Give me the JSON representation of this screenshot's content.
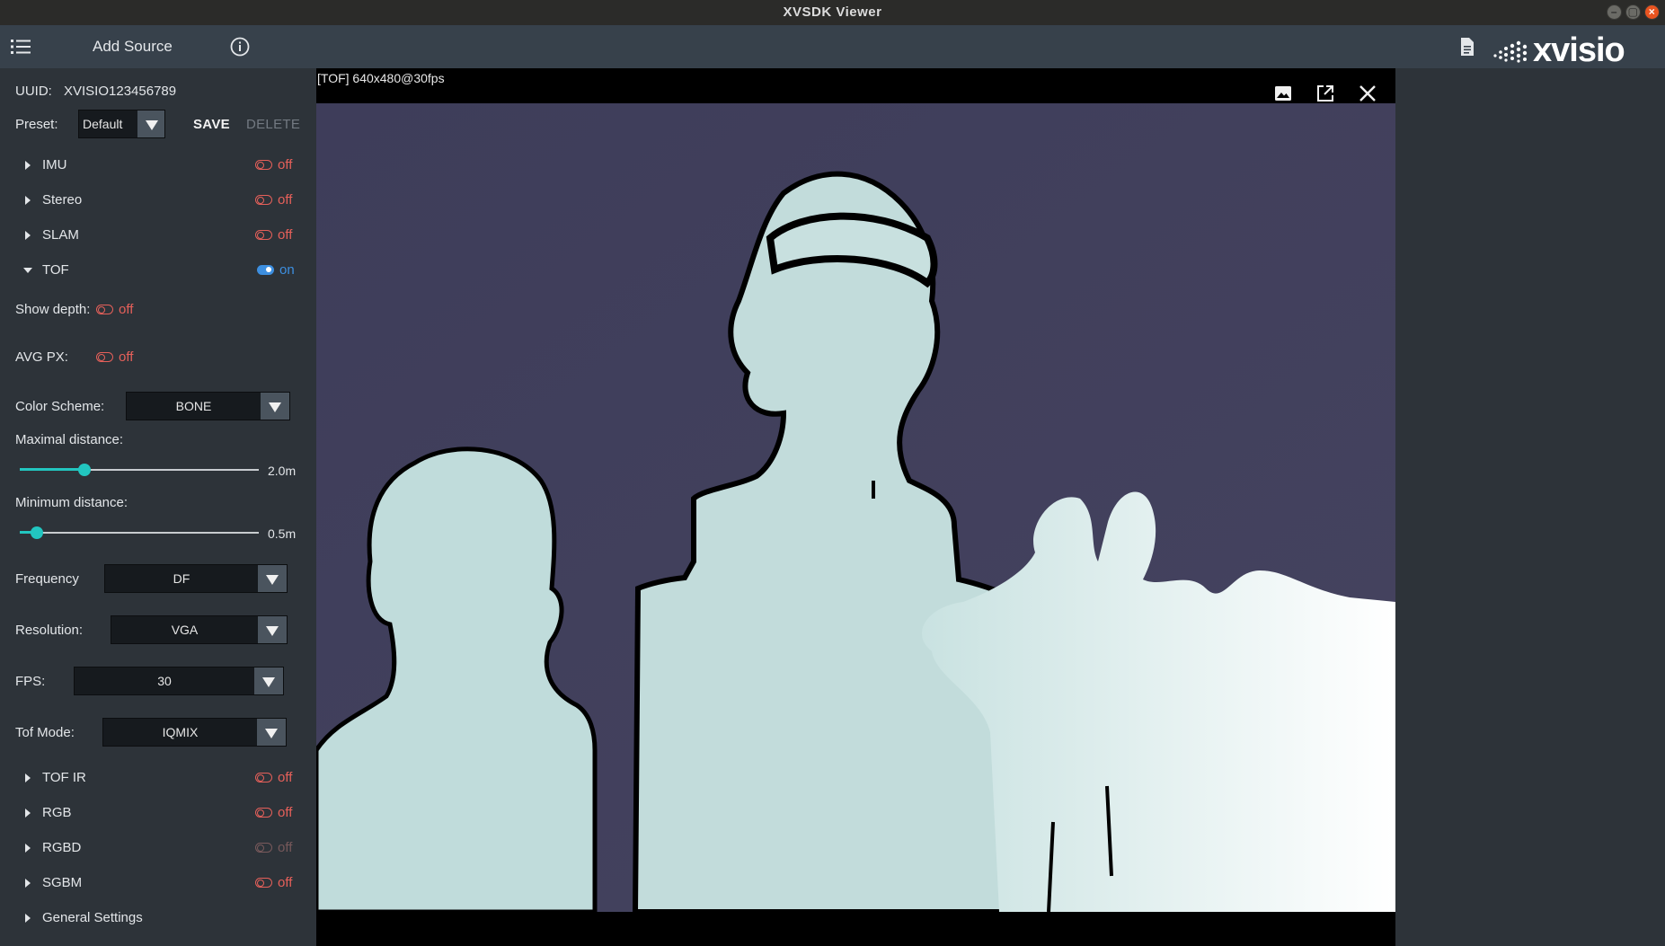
{
  "window": {
    "title": "XVSDK Viewer"
  },
  "toolbar": {
    "add_source": "Add Source",
    "brand": "XVISIO"
  },
  "device": {
    "uuid_label": "UUID:",
    "uuid_value": "XVISIO123456789"
  },
  "preset": {
    "label": "Preset:",
    "value": "Default",
    "save": "SAVE",
    "delete": "DELETE"
  },
  "modules": [
    {
      "label": "IMU",
      "state": "off"
    },
    {
      "label": "Stereo",
      "state": "off"
    },
    {
      "label": "SLAM",
      "state": "off"
    },
    {
      "label": "TOF",
      "state": "on"
    }
  ],
  "tof": {
    "show_depth": {
      "label": "Show depth:",
      "state": "off"
    },
    "avg_px": {
      "label": "AVG PX:",
      "state": "off"
    },
    "color_scheme": {
      "label": "Color Scheme:",
      "value": "BONE"
    },
    "max_distance": {
      "label": "Maximal distance:",
      "value": "2.0m",
      "fraction": 0.27
    },
    "min_distance": {
      "label": "Minimum distance:",
      "value": "0.5m",
      "fraction": 0.07
    },
    "frequency": {
      "label": "Frequency",
      "value": "DF"
    },
    "resolution": {
      "label": "Resolution:",
      "value": "VGA"
    },
    "fps": {
      "label": "FPS:",
      "value": "30"
    },
    "tof_mode": {
      "label": "Tof Mode:",
      "value": "IQMIX"
    }
  },
  "more_modules": [
    {
      "label": "TOF IR",
      "state": "off"
    },
    {
      "label": "RGB",
      "state": "off"
    },
    {
      "label": "RGBD",
      "state": "off",
      "disabled": true
    },
    {
      "label": "SGBM",
      "state": "off"
    }
  ],
  "general_settings": {
    "label": "General Settings"
  },
  "viewer": {
    "stream_label": "[TOF]  640x480@30fps"
  },
  "colors": {
    "on": "#3d8fe0",
    "off": "#e5605a",
    "accent": "#22c6c0",
    "depth_background": "#403e5c",
    "depth_near": "#c2dcdb"
  }
}
